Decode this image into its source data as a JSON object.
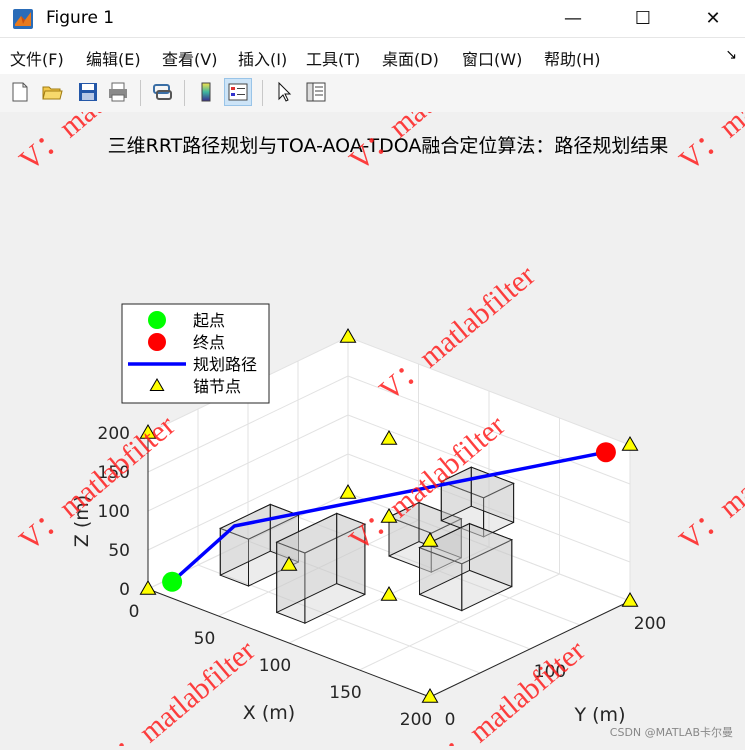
{
  "window": {
    "title": "Figure 1",
    "minimize": "—",
    "maximize": "☐",
    "close": "✕"
  },
  "menu": [
    {
      "label": "文件(F)",
      "key": "file"
    },
    {
      "label": "编辑(E)",
      "key": "edit"
    },
    {
      "label": "查看(V)",
      "key": "view"
    },
    {
      "label": "插入(I)",
      "key": "insert"
    },
    {
      "label": "工具(T)",
      "key": "tools"
    },
    {
      "label": "桌面(D)",
      "key": "desktop"
    },
    {
      "label": "窗口(W)",
      "key": "window"
    },
    {
      "label": "帮助(H)",
      "key": "help"
    }
  ],
  "menu_overflow_icon": "↘",
  "toolbar": [
    "new-figure-icon",
    "open-file-icon",
    "save-icon",
    "print-icon",
    "link-icon",
    "colorbar-icon",
    "legend-icon",
    "pointer-icon",
    "property-editor-icon"
  ],
  "plot": {
    "title": "三维RRT路径规划与TOA-AOA-TDOA融合定位算法：路径规划结果",
    "xlabel": "X (m)",
    "ylabel": "Y (m)",
    "zlabel": "Z (m)",
    "x_ticks": [
      "0",
      "50",
      "100",
      "150",
      "200"
    ],
    "y_ticks": [
      "0",
      "100",
      "200"
    ],
    "z_ticks": [
      "0",
      "50",
      "100",
      "150",
      "200"
    ],
    "legend": [
      "起点",
      "终点",
      "规划路径",
      "锚节点"
    ],
    "colors": {
      "start": "#00ff00",
      "end": "#ff0000",
      "path": "#0000ff",
      "anchor": "#ffff00"
    }
  },
  "chart_data": {
    "type": "scatter",
    "title": "三维RRT路径规划与TOA-AOA-TDOA融合定位算法：路径规划结果",
    "xlabel": "X (m)",
    "ylabel": "Y (m)",
    "zlabel": "Z (m)",
    "xlim": [
      0,
      200
    ],
    "ylim": [
      0,
      200
    ],
    "zlim": [
      0,
      200
    ],
    "grid": true,
    "legend_location": "upper-left",
    "start": [
      10,
      10,
      10
    ],
    "goal": [
      190,
      190,
      190
    ],
    "path": [
      [
        10,
        10,
        10
      ],
      [
        40,
        30,
        90
      ],
      [
        190,
        190,
        190
      ]
    ],
    "anchors": [
      [
        0,
        0,
        0
      ],
      [
        200,
        0,
        0
      ],
      [
        0,
        200,
        0
      ],
      [
        200,
        200,
        0
      ],
      [
        0,
        0,
        200
      ],
      [
        200,
        0,
        200
      ],
      [
        0,
        200,
        200
      ],
      [
        200,
        200,
        200
      ],
      [
        100,
        100,
        0
      ],
      [
        100,
        100,
        200
      ],
      [
        100,
        0,
        100
      ],
      [
        100,
        100,
        100
      ]
    ],
    "obstacles": [
      {
        "min": [
          30,
          30,
          20
        ],
        "max": [
          50,
          80,
          80
        ]
      },
      {
        "min": [
          70,
          30,
          0
        ],
        "max": [
          90,
          90,
          90
        ]
      },
      {
        "min": [
          100,
          100,
          50
        ],
        "max": [
          130,
          130,
          100
        ]
      },
      {
        "min": [
          130,
          110,
          110
        ],
        "max": [
          160,
          140,
          160
        ]
      },
      {
        "min": [
          150,
          60,
          60
        ],
        "max": [
          180,
          110,
          120
        ]
      }
    ]
  },
  "watermark": "V：matlabfilter",
  "credit": "CSDN @MATLAB卡尔曼"
}
